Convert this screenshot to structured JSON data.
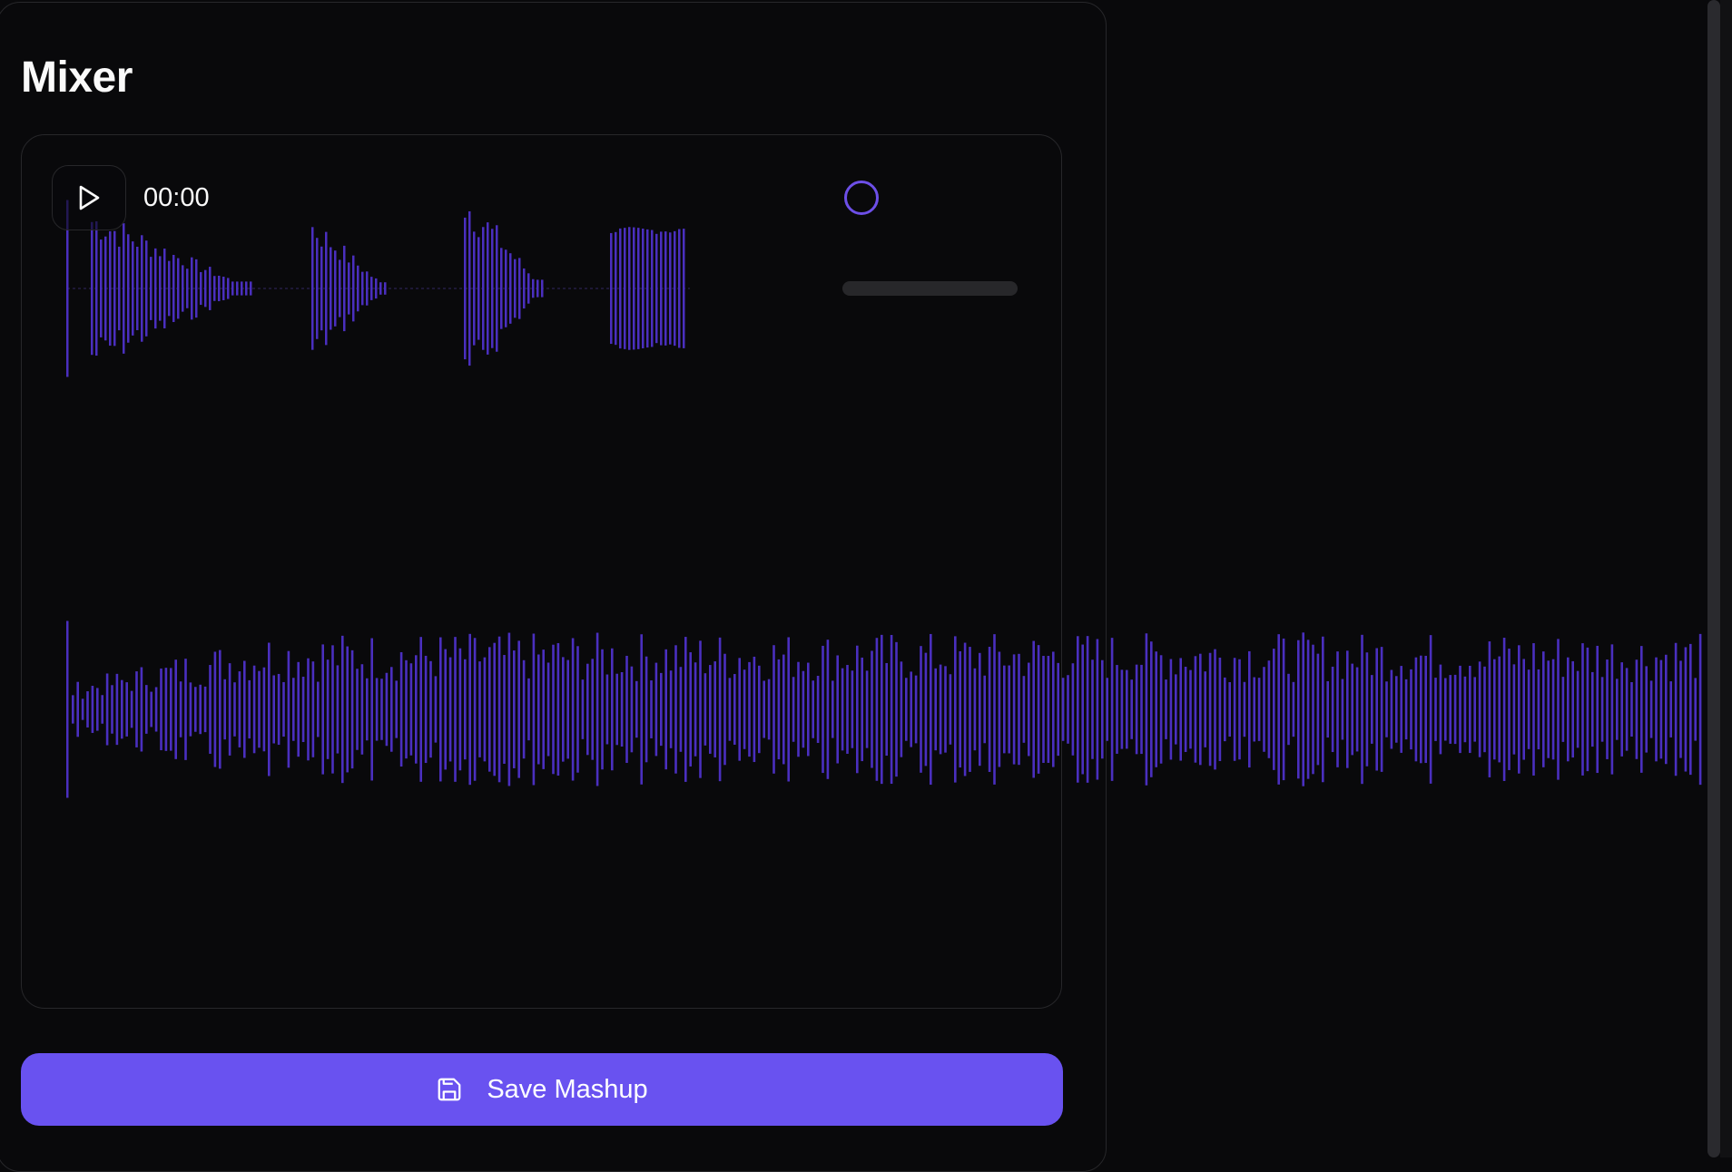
{
  "panel": {
    "title": "Mixer"
  },
  "player": {
    "time": "00:00",
    "play_icon": "play-icon",
    "volume_level": 0
  },
  "tracks": [
    {
      "name": "",
      "color": "#4a2fbf"
    },
    {
      "name": "",
      "color": "#4a2fbf"
    }
  ],
  "save_button": {
    "label": "Save Mashup",
    "icon": "save-icon"
  },
  "colors": {
    "background": "#09090b",
    "border": "#27272a",
    "accent": "#6952f0",
    "waveform": "#4a2fbf",
    "knob": "#6d4fe8"
  }
}
